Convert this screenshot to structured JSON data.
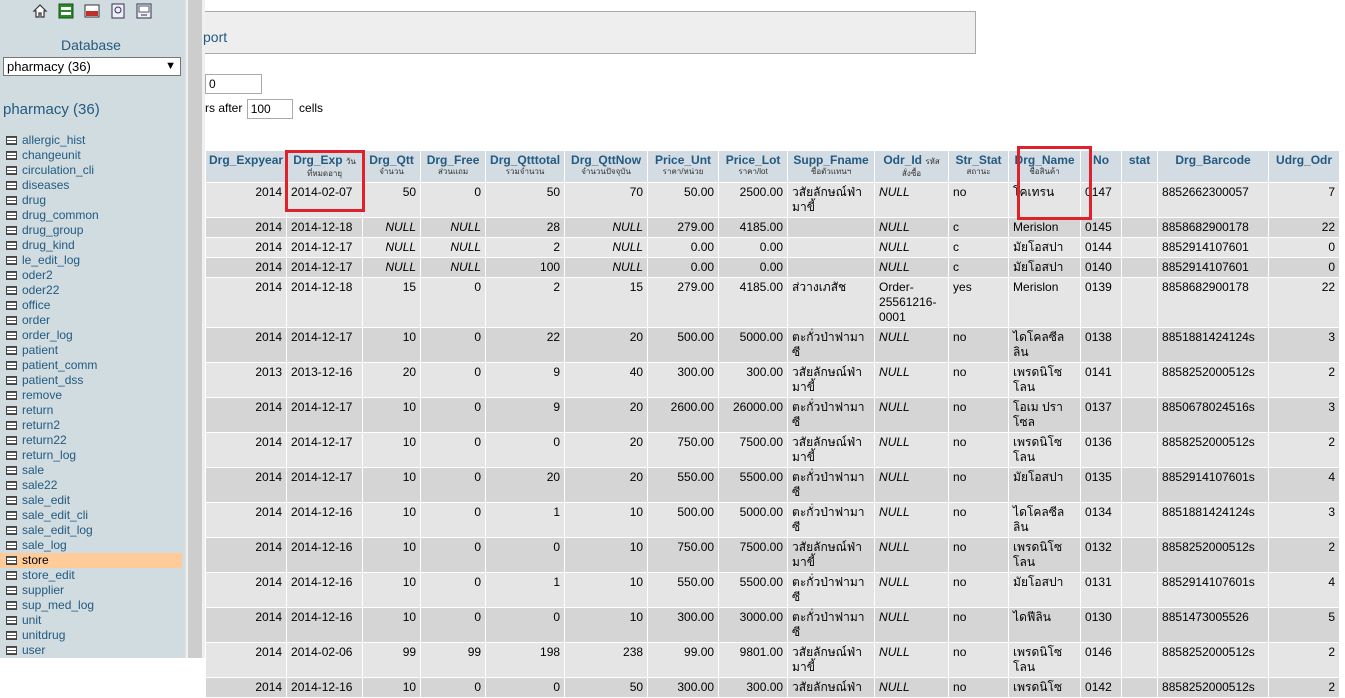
{
  "nav": {
    "db_label": "Database",
    "db_select": "pharmacy (36)",
    "db_title": "pharmacy (36)",
    "icons": [
      "home-icon",
      "export-icon",
      "sql-icon",
      "docs-icon",
      "query-window-icon"
    ],
    "tables": [
      "allergic_hist",
      "changeunit",
      "circulation_cli",
      "diseases",
      "drug",
      "drug_common",
      "drug_group",
      "drug_kind",
      "le_edit_log",
      "oder2",
      "oder22",
      "office",
      "order",
      "order_log",
      "patient",
      "patient_comm",
      "patient_dss",
      "remove",
      "return",
      "return2",
      "return22",
      "return_log",
      "sale",
      "sale22",
      "sale_edit",
      "sale_edit_cli",
      "sale_edit_log",
      "sale_log",
      "store",
      "store_edit",
      "supplier",
      "sup_med_log",
      "unit",
      "unitdrug",
      "user"
    ],
    "active_table": "store"
  },
  "main": {
    "top_link": "port",
    "rows_value": "0",
    "repeat_prefix": "rs after",
    "repeat_value": "100",
    "repeat_suffix": "cells"
  },
  "table": {
    "headers": [
      {
        "label": "Drg_Expyear",
        "sub": ""
      },
      {
        "label": "Drg_Exp",
        "inline": "วัน",
        "sub": "ที่หมดอายุ"
      },
      {
        "label": "Drg_Qtt",
        "sub": "จำนวน"
      },
      {
        "label": "Drg_Free",
        "sub": "ส่วนแถม"
      },
      {
        "label": "Drg_Qtttotal",
        "sub": "รวมจำนวน"
      },
      {
        "label": "Drg_QttNow",
        "sub": "จำนวนปัจจุบัน"
      },
      {
        "label": "Price_Unt",
        "sub": "ราคา/หน่วย"
      },
      {
        "label": "Price_Lot",
        "sub": "ราคา/lot"
      },
      {
        "label": "Supp_Fname",
        "sub": "ชื่อตัวแทนฯ"
      },
      {
        "label": "Odr_Id",
        "inline": "รหัส",
        "sub": "สั่งซื้อ"
      },
      {
        "label": "Str_Stat",
        "sub": "สถานะ"
      },
      {
        "label": "Drg_Name",
        "sub": "ชื่อสินค้า"
      },
      {
        "label": "No",
        "sub": ""
      },
      {
        "label": "stat",
        "sub": ""
      },
      {
        "label": "Drg_Barcode",
        "sub": ""
      },
      {
        "label": "Udrg_Odr",
        "sub": ""
      }
    ],
    "rows": [
      [
        "2014",
        "2014-02-07",
        "50",
        "0",
        "50",
        "70",
        "50.00",
        "2500.00",
        "วสัยลักษณ์ฟ่า มาขี้",
        "NULL",
        "no",
        "โคเทรน",
        "0147",
        "",
        "8852662300057",
        "7"
      ],
      [
        "2014",
        "2014-12-18",
        "NULL",
        "NULL",
        "28",
        "NULL",
        "279.00",
        "4185.00",
        "",
        "NULL",
        "c",
        "Merislon",
        "0145",
        "",
        "8858682900178",
        "22"
      ],
      [
        "2014",
        "2014-12-17",
        "NULL",
        "NULL",
        "2",
        "NULL",
        "0.00",
        "0.00",
        "",
        "NULL",
        "c",
        "มัยโอสปา",
        "0144",
        "",
        "8852914107601",
        "0"
      ],
      [
        "2014",
        "2014-12-17",
        "NULL",
        "NULL",
        "100",
        "NULL",
        "0.00",
        "0.00",
        "",
        "NULL",
        "c",
        "มัยโอสปา",
        "0140",
        "",
        "8852914107601",
        "0"
      ],
      [
        "2014",
        "2014-12-18",
        "15",
        "0",
        "2",
        "15",
        "279.00",
        "4185.00",
        "ส่วางเภสัช",
        "Order-25561216-0001",
        "yes",
        "Merislon",
        "0139",
        "",
        "8858682900178",
        "22"
      ],
      [
        "2014",
        "2014-12-17",
        "10",
        "0",
        "22",
        "20",
        "500.00",
        "5000.00",
        "ตะกั่วป่าฟามาซี",
        "NULL",
        "no",
        "ไดโคลซีล ลิน",
        "0138",
        "",
        "8851881424124s",
        "3"
      ],
      [
        "2013",
        "2013-12-16",
        "20",
        "0",
        "9",
        "40",
        "300.00",
        "300.00",
        "วสัยลักษณ์ฟ่า มาขี้",
        "NULL",
        "no",
        "เพรดนิโซ โลน",
        "0141",
        "",
        "8858252000512s",
        "2"
      ],
      [
        "2014",
        "2014-12-17",
        "10",
        "0",
        "9",
        "20",
        "2600.00",
        "26000.00",
        "ตะกั่วป่าฟามาซี",
        "NULL",
        "no",
        "โอเม ปราโซล",
        "0137",
        "",
        "8850678024516s",
        "3"
      ],
      [
        "2014",
        "2014-12-17",
        "10",
        "0",
        "0",
        "20",
        "750.00",
        "7500.00",
        "วสัยลักษณ์ฟ่า มาขี้",
        "NULL",
        "no",
        "เพรดนิโซ โลน",
        "0136",
        "",
        "8858252000512s",
        "2"
      ],
      [
        "2014",
        "2014-12-17",
        "10",
        "0",
        "20",
        "20",
        "550.00",
        "5500.00",
        "ตะกั่วป่าฟามาซี",
        "NULL",
        "no",
        "มัยโอสปา",
        "0135",
        "",
        "8852914107601s",
        "4"
      ],
      [
        "2014",
        "2014-12-16",
        "10",
        "0",
        "1",
        "10",
        "500.00",
        "5000.00",
        "ตะกั่วป่าฟามาซี",
        "NULL",
        "no",
        "ไดโคลซีล ลิน",
        "0134",
        "",
        "8851881424124s",
        "3"
      ],
      [
        "2014",
        "2014-12-16",
        "10",
        "0",
        "0",
        "10",
        "750.00",
        "7500.00",
        "วสัยลักษณ์ฟ่า มาขี้",
        "NULL",
        "no",
        "เพรดนิโซ โลน",
        "0132",
        "",
        "8858252000512s",
        "2"
      ],
      [
        "2014",
        "2014-12-16",
        "10",
        "0",
        "1",
        "10",
        "550.00",
        "5500.00",
        "ตะกั่วป่าฟามาซี",
        "NULL",
        "no",
        "มัยโอสปา",
        "0131",
        "",
        "8852914107601s",
        "4"
      ],
      [
        "2014",
        "2014-12-16",
        "10",
        "0",
        "0",
        "10",
        "300.00",
        "3000.00",
        "ตะกั่วป่าฟามาซี",
        "NULL",
        "no",
        "ไดฟีลิน",
        "0130",
        "",
        "8851473005526",
        "5"
      ],
      [
        "2014",
        "2014-02-06",
        "99",
        "99",
        "198",
        "238",
        "99.00",
        "9801.00",
        "วสัยลักษณ์ฟ่า มาขี้",
        "NULL",
        "no",
        "เพรดนิโซ โลน",
        "0146",
        "",
        "8858252000512s",
        "2"
      ],
      [
        "2014",
        "2014-12-16",
        "10",
        "0",
        "0",
        "50",
        "300.00",
        "300.00",
        "วสัยลักษณ์ฟ่า",
        "NULL",
        "no",
        "เพรดนิโซ",
        "0142",
        "",
        "8858252000512s",
        "2"
      ]
    ],
    "highlight_color": "#e0202a"
  }
}
